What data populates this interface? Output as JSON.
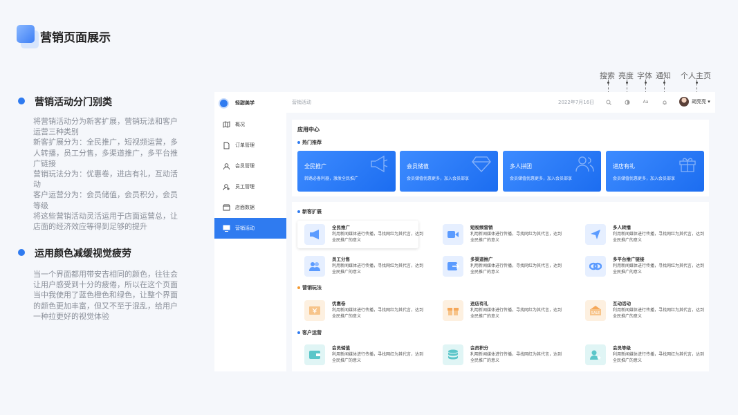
{
  "page": {
    "title": "营销页面展示"
  },
  "sections": [
    {
      "title": "营销活动分门别类",
      "text": "将营销活动分为新客扩展，营销玩法和客户\n运营三种类别\n新客扩展分为：全民推广，短视频运营，多\n人转播，员工分售，多渠道推广，多平台推\n广链接\n营销玩法分为：优惠卷，进店有礼，互动活\n动\n客户运营分为：会员储值，会员积分，会员\n等级\n将这些营销活动灵活运用于店面运营总，让\n店面的经济效应等得到足够的提升"
    },
    {
      "title": "运用颜色减缓视觉疲劳",
      "text": "当一个界面都用带安吉相同的颜色，往往会\n让用户感受到十分的疲倦，所以在这个页面\n当中我使用了蓝色橙色和绿色，让整个界面\n的颜色更加丰富，但又不至于混乱，给用户\n一种拉更好的视觉体验"
    }
  ],
  "annotations": [
    "搜索",
    "亮度",
    "字体",
    "通知",
    "个人主页"
  ],
  "app": {
    "brand": "轻甜美学",
    "nav": [
      {
        "label": "概况",
        "icon": "map-icon"
      },
      {
        "label": "订单管理",
        "icon": "document-icon"
      },
      {
        "label": "会员管理",
        "icon": "members-icon"
      },
      {
        "label": "员工管理",
        "icon": "staff-icon"
      },
      {
        "label": "店面数据",
        "icon": "store-icon"
      },
      {
        "label": "营销活动",
        "icon": "monitor-icon",
        "active": true
      }
    ],
    "topbar": {
      "breadcrumb": "营销活动",
      "date": "2022年7月16日",
      "font_icon_text": "Aa",
      "user": "胡亮亮 ▾"
    },
    "app_center": {
      "title": "应用中心",
      "hot_title": "热门推荐",
      "hot": [
        {
          "title": "全民推广",
          "desc": "转路必备利器，激发全民推广",
          "icon": "megaphone-icon"
        },
        {
          "title": "会员储值",
          "desc": "会员储值优惠更多，加入会员部享",
          "icon": "diamond-icon"
        },
        {
          "title": "多人拼团",
          "desc": "会员储值优惠更多，加入会员部享",
          "icon": "group-icon"
        },
        {
          "title": "进店有礼",
          "desc": "会员储值优惠更多，加入会员部享",
          "icon": "gift-icon"
        }
      ]
    },
    "groups": [
      {
        "title": "新客扩展",
        "color": "#2f7bf0",
        "items": [
          {
            "title": "全民推广",
            "desc": "利用新闻媒体进行传播，寻找网红为其代言，达到全民推广的意义",
            "icon": "megaphone-icon"
          },
          {
            "title": "短视频营销",
            "desc": "利用新闻媒体进行传播，寻找网红为其代言，达到全民推广的意义",
            "icon": "video-icon"
          },
          {
            "title": "多人转播",
            "desc": "利用新闻媒体进行传播，寻找网红为其代言，达到全民推广的意义",
            "icon": "send-icon"
          },
          {
            "title": "员工分售",
            "desc": "利用新闻媒体进行传播，寻找网红为其代言，达到全民推广的意义",
            "icon": "staff-group-icon"
          },
          {
            "title": "多渠道推广",
            "desc": "利用新闻媒体进行传播，寻找网红为其代言，达到全民推广的意义",
            "icon": "channel-icon"
          },
          {
            "title": "多平台推广链接",
            "desc": "利用新闻媒体进行传播，寻找网红为其代言，达到全民推广的意义",
            "icon": "link-icon"
          }
        ]
      },
      {
        "title": "营销玩法",
        "color": "#f39a33",
        "items": [
          {
            "title": "优惠卷",
            "desc": "利用新闻媒体进行传播，寻找网红为其代言，达到全民推广的意义",
            "icon": "coupon-icon"
          },
          {
            "title": "进店有礼",
            "desc": "利用新闻媒体进行传播，寻找网红为其代言，达到全民推广的意义",
            "icon": "gift-icon"
          },
          {
            "title": "互动活动",
            "desc": "利用新闻媒体进行传播，寻找网红为其代言，达到全民推广的意义",
            "icon": "sale-icon"
          }
        ]
      },
      {
        "title": "客户运营",
        "color": "#2f7bf0",
        "items": [
          {
            "title": "会员储值",
            "desc": "利用新闻媒体进行传播，寻找网红为其代言，达到全民推广的意义",
            "icon": "wallet-icon"
          },
          {
            "title": "会员积分",
            "desc": "利用新闻媒体进行传播，寻找网红为其代言，达到全民推广的意义",
            "icon": "coins-icon"
          },
          {
            "title": "会员等级",
            "desc": "利用新闻媒体进行传播，寻找网红为其代言，达到全民推广的意义",
            "icon": "member-level-icon"
          }
        ]
      }
    ]
  }
}
